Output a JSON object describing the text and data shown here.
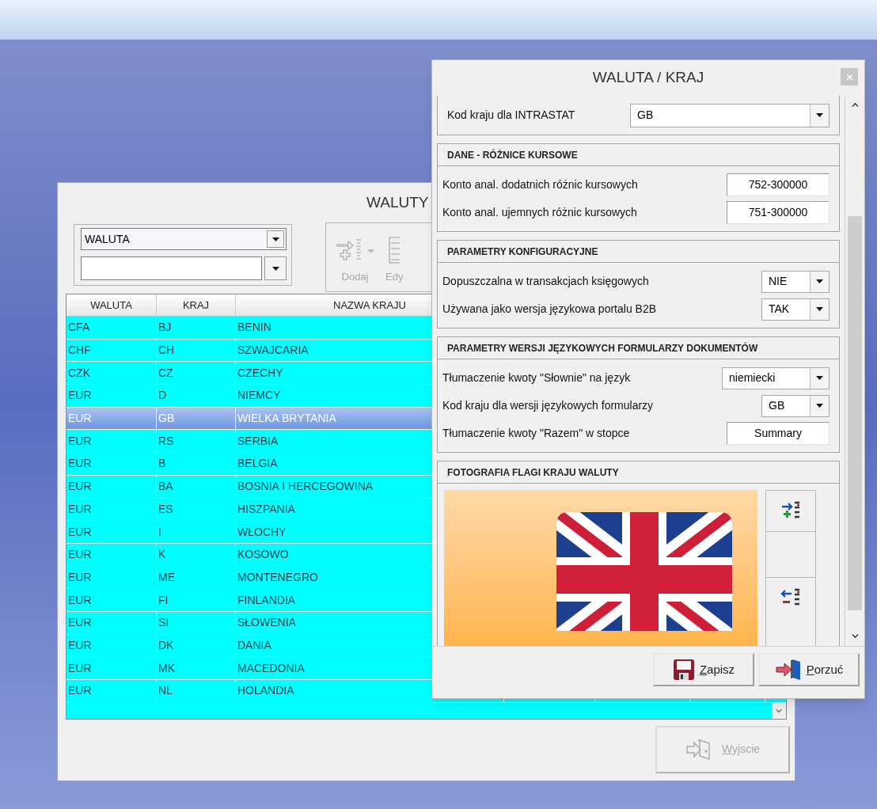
{
  "list_window": {
    "title": "WALUTY",
    "filter_combo": "WALUTA",
    "toolbar": [
      {
        "kind": "add",
        "label": "Dodaj",
        "disabled": true
      },
      {
        "kind": "edit",
        "label": "Edy",
        "disabled": true
      }
    ],
    "table": {
      "columns": [
        "WALUTA",
        "KRAJ",
        "NAZWA KRAJU"
      ],
      "rows": [
        {
          "cells": [
            "CFA",
            "BJ",
            "BENIN"
          ],
          "selected": false
        },
        {
          "cells": [
            "CHF",
            "CH",
            "SZWAJCARIA"
          ],
          "selected": false
        },
        {
          "cells": [
            "CZK",
            "CZ",
            "CZECHY"
          ],
          "selected": false
        },
        {
          "cells": [
            "EUR",
            "D",
            "NIEMCY"
          ],
          "selected": false
        },
        {
          "cells": [
            "EUR",
            "GB",
            "WIELKA BRYTANIA"
          ],
          "selected": true
        },
        {
          "cells": [
            "EUR",
            "RS",
            "SERBIA"
          ],
          "selected": false
        },
        {
          "cells": [
            "EUR",
            "B",
            "BELGIA"
          ],
          "selected": false
        },
        {
          "cells": [
            "EUR",
            "BA",
            "BOSNIA I HERCEGOWINA"
          ],
          "selected": false
        },
        {
          "cells": [
            "EUR",
            "ES",
            "HISZPANIA"
          ],
          "selected": false
        },
        {
          "cells": [
            "EUR",
            "I",
            "WŁOCHY"
          ],
          "selected": false
        },
        {
          "cells": [
            "EUR",
            "K",
            "KOSOWO"
          ],
          "selected": false
        },
        {
          "cells": [
            "EUR",
            "ME",
            "MONTENEGRO"
          ],
          "selected": false
        },
        {
          "cells": [
            "EUR",
            "FI",
            "FINLANDIA"
          ],
          "selected": false
        },
        {
          "cells": [
            "EUR",
            "SI",
            "SŁOWENIA"
          ],
          "selected": false
        },
        {
          "cells": [
            "EUR",
            "DK",
            "DANIA"
          ],
          "selected": false
        },
        {
          "cells": [
            "EUR",
            "MK",
            "MACEDONIA"
          ],
          "selected": false
        },
        {
          "cells": [
            "EUR",
            "NL",
            "HOLANDIA"
          ],
          "selected": false
        }
      ]
    },
    "exit_button": {
      "label": "Wyjscie",
      "disabled": true
    }
  },
  "dialog": {
    "title": "WALUTA / KRAJ",
    "intrastat": {
      "label": "Kod kraju dla INTRASTAT",
      "value": "GB"
    },
    "sections": [
      {
        "title": "DANE - RÓŻNICE KURSOWE",
        "fields": [
          {
            "kind": "input",
            "label": "Konto anal. dodatnich różnic kursowych",
            "value": "752-300000"
          },
          {
            "kind": "input",
            "label": "Konto anal. ujemnych różnic kursowych",
            "value": "751-300000"
          }
        ]
      },
      {
        "title": "PARAMETRY KONFIGURACYJNE",
        "fields": [
          {
            "kind": "small-combo",
            "label": "Dopuszczalna w  transakcjach księgowych",
            "value": "NIE"
          },
          {
            "kind": "small-combo",
            "label": "Używana jako wersja językowa portalu B2B",
            "value": "TAK"
          }
        ]
      },
      {
        "title": "PARAMETRY WERSJI JĘZYKOWYCH FORMULARZY DOKUMENTÓW",
        "fields": [
          {
            "kind": "combo",
            "label": "Tłumaczenie kwoty \"Słownie\" na język",
            "value": "niemiecki"
          },
          {
            "kind": "small-combo",
            "label": "Kod kraju dla wersji językowych formularzy",
            "value": "GB"
          },
          {
            "kind": "input",
            "label": "Tłumaczenie kwoty \"Razem\"  w stopce",
            "value": "Summary"
          }
        ]
      }
    ],
    "photo_section": {
      "title": "FOTOGRAFIA FLAGI KRAJU WALUTY"
    },
    "buttons": [
      {
        "kind": "save",
        "label": "Zapisz"
      },
      {
        "kind": "discard",
        "label": "Porzuć"
      }
    ]
  }
}
